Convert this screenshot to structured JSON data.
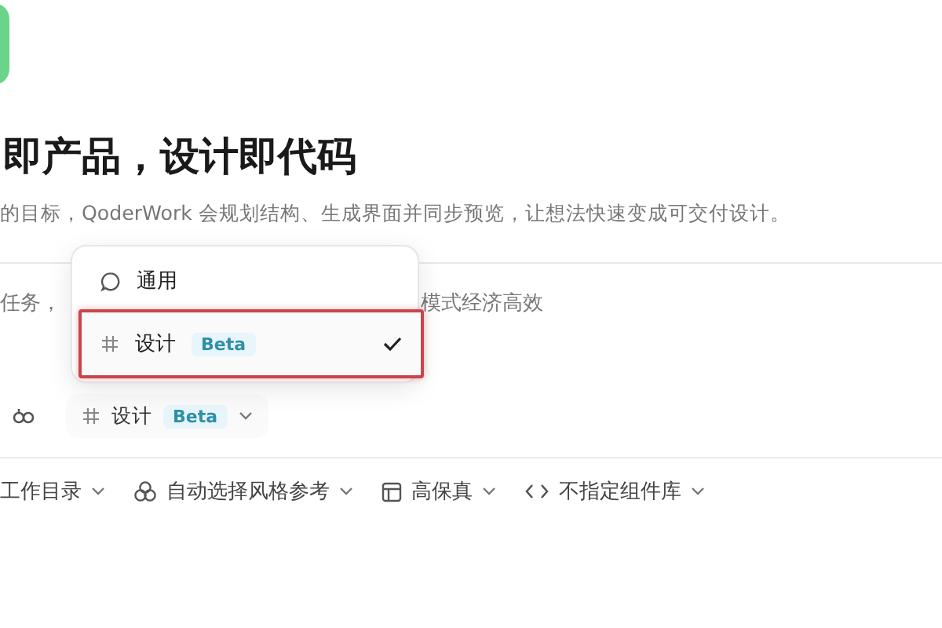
{
  "heading": "即产品，设计即代码",
  "subtitle": "的目标，QoderWork 会规划结构、生成界面并同步预览，让想法快速变成可交付设计。",
  "composer": {
    "placeholder_parts": [
      "任务，",
      "模式经济高效"
    ],
    "mode_button": {
      "kind": "design",
      "label": "设计",
      "badge": "Beta"
    }
  },
  "mode_menu": {
    "items": [
      {
        "kind": "general",
        "label": "通用",
        "selected": false,
        "highlighted": false
      },
      {
        "kind": "design",
        "label": "设计",
        "badge": "Beta",
        "selected": true,
        "highlighted": true
      }
    ]
  },
  "toolbar": [
    {
      "kind": "workdir",
      "label": "工作目录"
    },
    {
      "kind": "style",
      "label": "自动选择风格参考"
    },
    {
      "kind": "fidelity",
      "label": "高保真"
    },
    {
      "kind": "library",
      "label": "不指定组件库"
    }
  ]
}
